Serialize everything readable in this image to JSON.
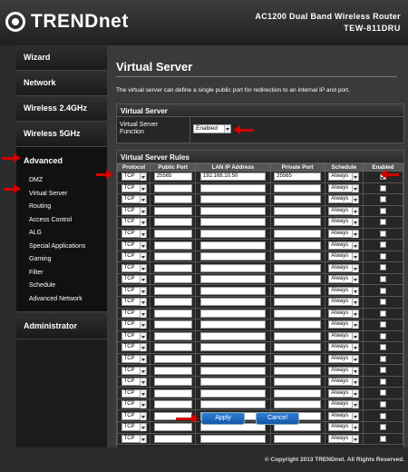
{
  "brand": {
    "logo_text": "TRENDnet"
  },
  "router": {
    "model_name": "AC1200 Dual Band Wireless Router",
    "model_number": "TEW-811DRU"
  },
  "sidebar": {
    "wizard": "Wizard",
    "network": "Network",
    "wireless24": "Wireless 2.4GHz",
    "wireless5": "Wireless 5GHz",
    "advanced": "Advanced",
    "sub_items": [
      "DMZ",
      "Virtual Server",
      "Routing",
      "Access Control",
      "ALG",
      "Special Applications",
      "Gaming",
      "Filter",
      "Schedule",
      "Advanced Network"
    ],
    "administrator": "Administrator"
  },
  "main": {
    "title": "Virtual Server",
    "intro": "The virtual server can define a single public port for redirection to an internal IP and port."
  },
  "virtual_server_panel": {
    "heading": "Virtual Server",
    "function_label": "Virtual Server Function",
    "function_value": "Enabled"
  },
  "rules_panel": {
    "heading": "Virtual Server Rules",
    "columns": [
      "Protocol",
      "Public Port",
      "LAN IP Address",
      "Private Port",
      "Schedule",
      "Enabled"
    ],
    "rows": [
      {
        "protocol": "TCP",
        "public_port": "25565",
        "lan_ip": "192.168.10.50",
        "private_port": "25565",
        "schedule": "Always",
        "enabled": true
      },
      {
        "protocol": "TCP",
        "public_port": "",
        "lan_ip": "",
        "private_port": "",
        "schedule": "Always",
        "enabled": false
      },
      {
        "protocol": "TCP",
        "public_port": "",
        "lan_ip": "",
        "private_port": "",
        "schedule": "Always",
        "enabled": false
      },
      {
        "protocol": "TCP",
        "public_port": "",
        "lan_ip": "",
        "private_port": "",
        "schedule": "Always",
        "enabled": false
      },
      {
        "protocol": "TCP",
        "public_port": "",
        "lan_ip": "",
        "private_port": "",
        "schedule": "Always",
        "enabled": false
      },
      {
        "protocol": "TCP",
        "public_port": "",
        "lan_ip": "",
        "private_port": "",
        "schedule": "Always",
        "enabled": false
      },
      {
        "protocol": "TCP",
        "public_port": "",
        "lan_ip": "",
        "private_port": "",
        "schedule": "Always",
        "enabled": false
      },
      {
        "protocol": "TCP",
        "public_port": "",
        "lan_ip": "",
        "private_port": "",
        "schedule": "Always",
        "enabled": false
      },
      {
        "protocol": "TCP",
        "public_port": "",
        "lan_ip": "",
        "private_port": "",
        "schedule": "Always",
        "enabled": false
      },
      {
        "protocol": "TCP",
        "public_port": "",
        "lan_ip": "",
        "private_port": "",
        "schedule": "Always",
        "enabled": false
      },
      {
        "protocol": "TCP",
        "public_port": "",
        "lan_ip": "",
        "private_port": "",
        "schedule": "Always",
        "enabled": false
      },
      {
        "protocol": "TCP",
        "public_port": "",
        "lan_ip": "",
        "private_port": "",
        "schedule": "Always",
        "enabled": false
      },
      {
        "protocol": "TCP",
        "public_port": "",
        "lan_ip": "",
        "private_port": "",
        "schedule": "Always",
        "enabled": false
      },
      {
        "protocol": "TCP",
        "public_port": "",
        "lan_ip": "",
        "private_port": "",
        "schedule": "Always",
        "enabled": false
      },
      {
        "protocol": "TCP",
        "public_port": "",
        "lan_ip": "",
        "private_port": "",
        "schedule": "Always",
        "enabled": false
      },
      {
        "protocol": "TCP",
        "public_port": "",
        "lan_ip": "",
        "private_port": "",
        "schedule": "Always",
        "enabled": false
      },
      {
        "protocol": "TCP",
        "public_port": "",
        "lan_ip": "",
        "private_port": "",
        "schedule": "Always",
        "enabled": false
      },
      {
        "protocol": "TCP",
        "public_port": "",
        "lan_ip": "",
        "private_port": "",
        "schedule": "Always",
        "enabled": false
      },
      {
        "protocol": "TCP",
        "public_port": "",
        "lan_ip": "",
        "private_port": "",
        "schedule": "Always",
        "enabled": false
      },
      {
        "protocol": "TCP",
        "public_port": "",
        "lan_ip": "",
        "private_port": "",
        "schedule": "Always",
        "enabled": false
      },
      {
        "protocol": "TCP",
        "public_port": "",
        "lan_ip": "",
        "private_port": "",
        "schedule": "Always",
        "enabled": false
      },
      {
        "protocol": "TCP",
        "public_port": "",
        "lan_ip": "",
        "private_port": "",
        "schedule": "Always",
        "enabled": false
      },
      {
        "protocol": "TCP",
        "public_port": "",
        "lan_ip": "",
        "private_port": "",
        "schedule": "Always",
        "enabled": false
      },
      {
        "protocol": "TCP",
        "public_port": "",
        "lan_ip": "",
        "private_port": "",
        "schedule": "Always",
        "enabled": false
      }
    ]
  },
  "buttons": {
    "apply": "Apply",
    "cancel": "Cancel"
  },
  "footer": {
    "copyright": "© Copyright 2013 TRENDnet. All Rights Reserved."
  },
  "colors": {
    "accent_button": "#1e6cc8",
    "annotation_arrow": "#d40000"
  }
}
